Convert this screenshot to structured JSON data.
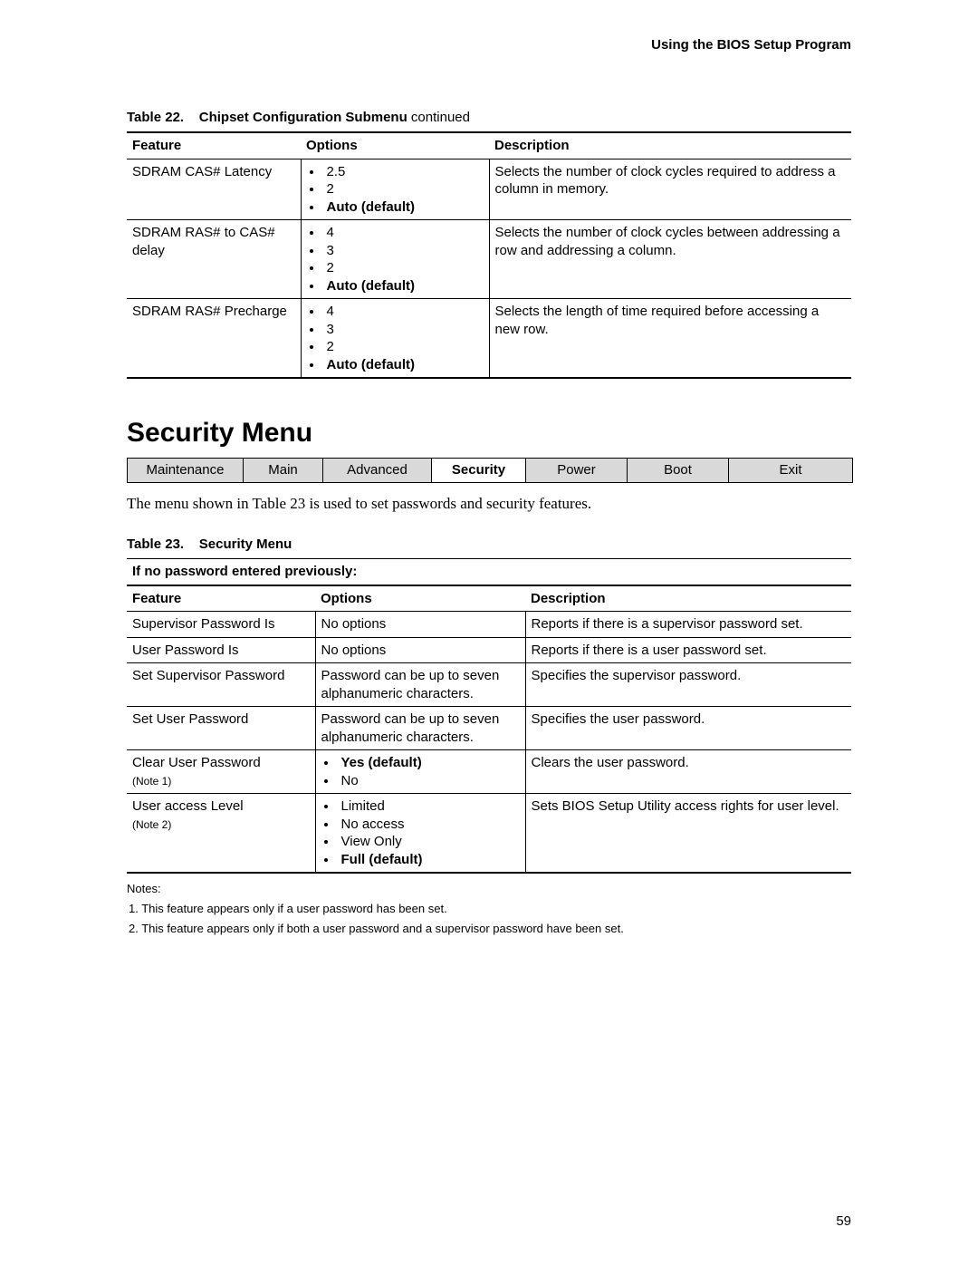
{
  "header": "Using the BIOS Setup Program",
  "page_number": "59",
  "table22": {
    "caption_num": "Table 22.",
    "caption_title": "Chipset Configuration Submenu",
    "caption_suffix": " continued",
    "headers": {
      "c1": "Feature",
      "c2": "Options",
      "c3": "Description"
    },
    "rows": [
      {
        "feature": "SDRAM CAS# Latency",
        "options": [
          {
            "label": "2.5",
            "bold": false
          },
          {
            "label": "2",
            "bold": false
          },
          {
            "label": "Auto (default)",
            "bold": true
          }
        ],
        "description": "Selects the number of clock cycles required to address a column in memory."
      },
      {
        "feature": "SDRAM RAS# to CAS# delay",
        "options": [
          {
            "label": "4",
            "bold": false
          },
          {
            "label": "3",
            "bold": false
          },
          {
            "label": "2",
            "bold": false
          },
          {
            "label": "Auto (default)",
            "bold": true
          }
        ],
        "description": "Selects the number of clock cycles between addressing a row and addressing a column."
      },
      {
        "feature": "SDRAM RAS# Precharge",
        "options": [
          {
            "label": "4",
            "bold": false
          },
          {
            "label": "3",
            "bold": false
          },
          {
            "label": "2",
            "bold": false
          },
          {
            "label": "Auto (default)",
            "bold": true
          }
        ],
        "description": "Selects the length of time required before accessing a new row."
      }
    ]
  },
  "section_title": "Security Menu",
  "tabs": [
    {
      "label": "Maintenance",
      "active": false,
      "w": "16%"
    },
    {
      "label": "Main",
      "active": false,
      "w": "11%"
    },
    {
      "label": "Advanced",
      "active": false,
      "w": "15%"
    },
    {
      "label": "Security",
      "active": true,
      "w": "13%"
    },
    {
      "label": "Power",
      "active": false,
      "w": "14%"
    },
    {
      "label": "Boot",
      "active": false,
      "w": "14%"
    },
    {
      "label": "Exit",
      "active": false,
      "w": "17%"
    }
  ],
  "intro_text": "The menu shown in Table 23 is used to set passwords and security features.",
  "table23": {
    "caption_num": "Table 23.",
    "caption_title": "Security Menu",
    "subheader": "If no password entered previously:",
    "headers": {
      "c1": "Feature",
      "c2": "Options",
      "c3": "Description"
    },
    "rows": [
      {
        "feature": "Supervisor Password Is",
        "note": "",
        "options_text": "No options",
        "description": "Reports if there is a supervisor password set."
      },
      {
        "feature": "User Password Is",
        "note": "",
        "options_text": "No options",
        "description": "Reports if there is a user password set."
      },
      {
        "feature": "Set Supervisor Password",
        "note": "",
        "options_text": "Password can be up to seven alphanumeric characters.",
        "description": "Specifies the supervisor password."
      },
      {
        "feature": "Set User Password",
        "note": "",
        "options_text": "Password can be up to seven alphanumeric characters.",
        "description": "Specifies the user password."
      },
      {
        "feature": "Clear User Password",
        "note": "(Note 1)",
        "options": [
          {
            "label": "Yes (default)",
            "bold": true
          },
          {
            "label": "No",
            "bold": false
          }
        ],
        "description": "Clears the user password."
      },
      {
        "feature": "User access Level",
        "note": "(Note 2)",
        "options": [
          {
            "label": "Limited",
            "bold": false
          },
          {
            "label": "No access",
            "bold": false
          },
          {
            "label": "View Only",
            "bold": false
          },
          {
            "label": "Full (default)",
            "bold": true
          }
        ],
        "description": "Sets BIOS Setup Utility access rights for user level."
      }
    ]
  },
  "notes": {
    "label": "Notes:",
    "items": [
      "1.    This feature appears only if a user password has been set.",
      "2.    This feature appears only if both a user password and a supervisor password have been set."
    ]
  }
}
